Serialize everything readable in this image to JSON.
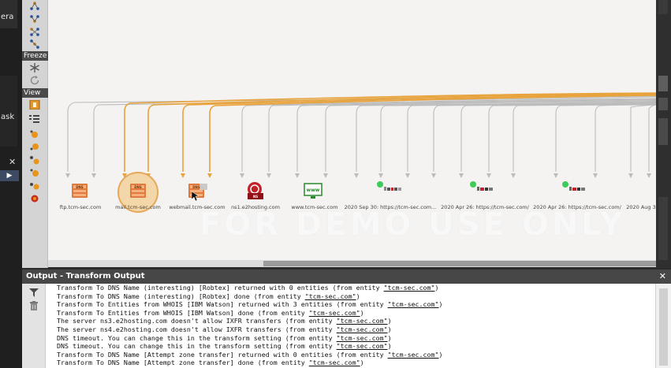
{
  "left_panel": {
    "cut_texts": [
      "era",
      "ask"
    ],
    "close_glyph": "✕",
    "arrow_glyph": "▶"
  },
  "toolbar": {
    "freeze_label": "Freeze",
    "view_label": "View",
    "icons": [
      "hierarchy-layout-icon",
      "organic-layout-icon",
      "circular-layout-icon",
      "interactive-layout-icon",
      "freeze-icon",
      "refresh-icon",
      "view-icon",
      "list-view-icon",
      "bubble-view-icon-1",
      "bubble-view-icon-2",
      "bubble-view-icon-3",
      "bubble-view-icon-4",
      "bubble-view-icon-5",
      "bubble-view-icon-6"
    ]
  },
  "graph": {
    "watermark": "FOR DEMO USE ONLY",
    "colors": {
      "edge_highlight": "#e8a33d",
      "edge_gray": "#b9b9b9",
      "mx_server": "#e0743c",
      "dns_icon": "#d9551f",
      "ns_icon": "#c12229",
      "www_icon": "#2a8a2a",
      "online_dot": "#3bcc5a"
    },
    "nodes": [
      {
        "label": "ftp.tcm-sec.com",
        "type": "dns-name",
        "icon": "dns-server-icon"
      },
      {
        "label": "mail.tcm-sec.com",
        "type": "dns-name",
        "icon": "dns-server-icon",
        "selected": true
      },
      {
        "label": "webmail.tcm-sec.com",
        "type": "dns-name",
        "icon": "dns-server-icon"
      },
      {
        "label": "ns1.e2hosting.com",
        "type": "name-server",
        "icon": "name-server-icon"
      },
      {
        "label": "www.tcm-sec.com",
        "type": "website",
        "icon": "www-icon"
      },
      {
        "label": "2020 Sep 30: https://tcm-sec.com...",
        "type": "web-archive",
        "icon": "archive-snapshot-icon"
      },
      {
        "label": "2020 Apr 26: https://tcm-sec.com/",
        "type": "web-archive",
        "icon": "archive-snapshot-icon"
      },
      {
        "label": "2020 Apr 26: https://tcm-sec.com/",
        "type": "web-archive",
        "icon": "archive-snapshot-icon"
      },
      {
        "label": "2020 Aug 3",
        "type": "web-archive",
        "icon": "archive-snapshot-icon"
      }
    ]
  },
  "output": {
    "title": "Output - Transform Output",
    "close_glyph": "✕",
    "lines": [
      {
        "text": "Transform To DNS Name (interesting) [Robtex] returned with 0 entities (from entity ",
        "entity": "\"tcm-sec.com\"",
        "tail": ")"
      },
      {
        "text": "Transform To DNS Name (interesting) [Robtex] done (from entity ",
        "entity": "\"tcm-sec.com\"",
        "tail": ")"
      },
      {
        "text": "Transform To Entities from WHOIS [IBM Watson] returned with 3 entities (from entity ",
        "entity": "\"tcm-sec.com\"",
        "tail": ")"
      },
      {
        "text": "Transform To Entities from WHOIS [IBM Watson] done (from entity ",
        "entity": "\"tcm-sec.com\"",
        "tail": ")"
      },
      {
        "text": "The server ns3.e2hosting.com doesn't allow IXFR transfers (from entity ",
        "entity": "\"tcm-sec.com\"",
        "tail": ")"
      },
      {
        "text": "The server ns4.e2hosting.com doesn't allow IXFR transfers (from entity ",
        "entity": "\"tcm-sec.com\"",
        "tail": ")"
      },
      {
        "text": "DNS timeout. You can change this in the transform setting (from entity ",
        "entity": "\"tcm-sec.com\"",
        "tail": ")"
      },
      {
        "text": "DNS timeout. You can change this in the transform setting (from entity ",
        "entity": "\"tcm-sec.com\"",
        "tail": ")"
      },
      {
        "text": "Transform To DNS Name [Attempt zone transfer] returned with 0 entities (from entity ",
        "entity": "\"tcm-sec.com\"",
        "tail": ")"
      },
      {
        "text": "Transform To DNS Name [Attempt zone transfer] done (from entity ",
        "entity": "\"tcm-sec.com\"",
        "tail": ")"
      }
    ]
  }
}
